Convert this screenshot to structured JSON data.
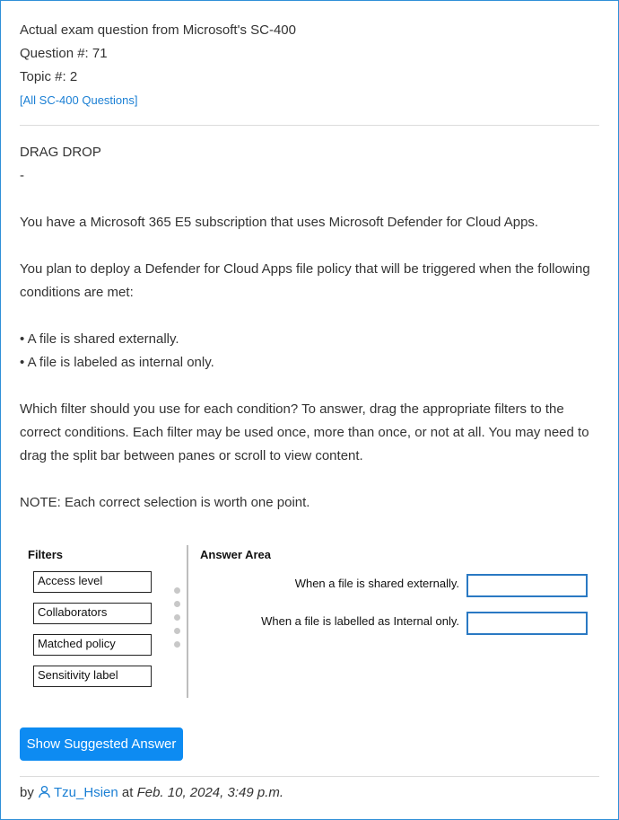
{
  "header": {
    "title": "Actual exam question from Microsoft's SC-400",
    "question_number": "Question #: 71",
    "topic": "Topic #: 2",
    "all_questions_link": "[All SC-400 Questions]"
  },
  "question": {
    "type": "DRAG DROP",
    "dash": "-",
    "p1": "You have a Microsoft 365 E5 subscription that uses Microsoft Defender for Cloud Apps.",
    "p2": "You plan to deploy a Defender for Cloud Apps file policy that will be triggered when the following conditions are met:",
    "bullets": [
      "• A file is shared externally.",
      "• A file is labeled as internal only."
    ],
    "p3": "Which filter should you use for each condition? To answer, drag the appropriate filters to the correct conditions. Each filter may be used once, more than once, or not at all. You may need to drag the split bar between panes or scroll to view content.",
    "note": "NOTE: Each correct selection is worth one point."
  },
  "figure": {
    "filters_title": "Filters",
    "filters": [
      "Access level",
      "Collaborators",
      "Matched policy",
      "Sensitivity label"
    ],
    "answer_title": "Answer Area",
    "conditions": [
      "When a file is shared externally.",
      "When a file is labelled as Internal only."
    ]
  },
  "actions": {
    "show_answer_label": "Show Suggested Answer"
  },
  "footer": {
    "by": "by",
    "user": "Tzu_Hsien",
    "at": "at",
    "date": "Feb. 10, 2024, 3:49 p.m."
  },
  "colors": {
    "accent": "#0d8bf2",
    "link": "#1a7fd4",
    "border": "#2f8fd8",
    "drop_box": "#2a79c3"
  }
}
